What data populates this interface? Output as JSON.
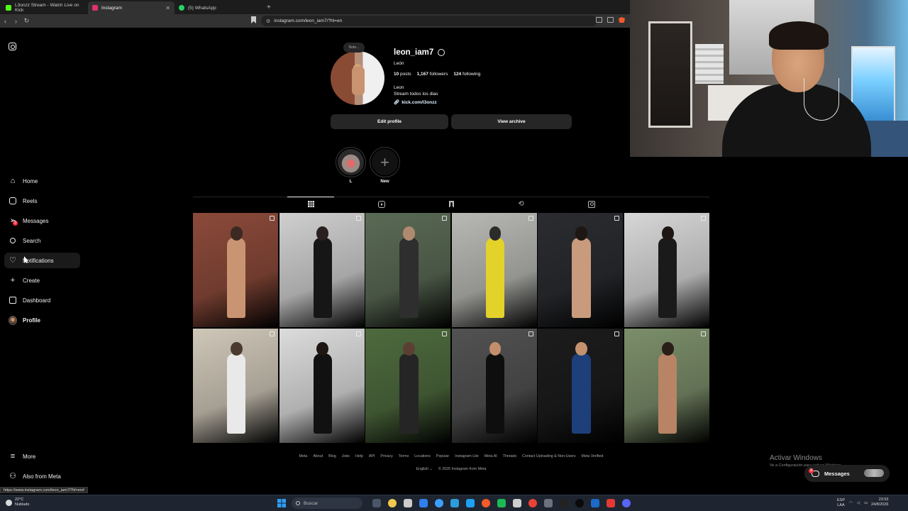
{
  "browser": {
    "tabs": [
      {
        "title": "L3onzz Stream - Watch Live on Kick",
        "color": "#53fc18"
      },
      {
        "title": "Instagram",
        "color": "#e1306c"
      },
      {
        "title": "(5) WhatsApp",
        "color": "#25d366"
      }
    ],
    "url": "instagram.com/leon_iam7/?hl=en"
  },
  "sidebar": {
    "items": [
      {
        "label": "Home",
        "icon": "home-icon"
      },
      {
        "label": "Reels",
        "icon": "reels-icon"
      },
      {
        "label": "Messages",
        "icon": "messages-icon",
        "badge": "3"
      },
      {
        "label": "Search",
        "icon": "search-icon"
      },
      {
        "label": "Notifications",
        "icon": "heart-icon"
      },
      {
        "label": "Create",
        "icon": "plus-icon"
      },
      {
        "label": "Dashboard",
        "icon": "dashboard-icon"
      },
      {
        "label": "Profile",
        "icon": "avatar"
      }
    ],
    "more": "More",
    "also_from_meta": "Also from Meta"
  },
  "profile": {
    "note": "Note...",
    "username": "leon_iam7",
    "full_name": "León",
    "posts": "10",
    "posts_label": "posts",
    "followers": "1,167",
    "followers_label": "followers",
    "following": "124",
    "following_label": "following",
    "bio_name": "Leon",
    "bio_text": "Stream todos los dias",
    "link": "kick.com/l3onzz",
    "edit_profile": "Edit profile",
    "view_archive": "View archive"
  },
  "highlights": [
    {
      "label": "L"
    },
    {
      "label": "New"
    }
  ],
  "posts": [
    {
      "bg": "#8b4a3a",
      "fig": "#c99472",
      "head": "#3b2a22"
    },
    {
      "bg": "#cfcfcf",
      "fig": "#161616",
      "head": "#2a2020"
    },
    {
      "bg": "#5a6a55",
      "fig": "#2e2e2e",
      "head": "#b08a70"
    },
    {
      "bg": "#b8b8b4",
      "fig": "#e3d22a",
      "head": "#2b2b2b"
    },
    {
      "bg": "#2a2c30",
      "fig": "#c89b7d",
      "head": "#1e1612"
    },
    {
      "bg": "#d7d7d7",
      "fig": "#1a1a1a",
      "head": "#1e1612"
    },
    {
      "bg": "#cfc7b8",
      "fig": "#e9e9e9",
      "head": "#4a3a2f"
    },
    {
      "bg": "#dcdcdc",
      "fig": "#111111",
      "head": "#1e1612"
    },
    {
      "bg": "#4e6a3e",
      "fig": "#252525",
      "head": "#5a4032"
    },
    {
      "bg": "#525252",
      "fig": "#0e0e0e",
      "head": "#c48e6c"
    },
    {
      "bg": "#1c1c1c",
      "fig": "#1d3f7a",
      "head": "#c4926f"
    },
    {
      "bg": "#7b8e6a",
      "fig": "#b88465",
      "head": "#2a1e18"
    }
  ],
  "footer": {
    "links": [
      "Meta",
      "About",
      "Blog",
      "Jobs",
      "Help",
      "API",
      "Privacy",
      "Terms",
      "Locations",
      "Popular",
      "Instagram Lite",
      "Meta AI",
      "Threads",
      "Contact Uploading & Non-Users",
      "Meta Verified"
    ],
    "language": "English",
    "copyright": "© 2026 Instagram from Meta"
  },
  "windows": {
    "activate_title": "Activar Windows",
    "activate_sub": "Ve a Configuración para activar Windows."
  },
  "messages_pill": {
    "label": "Messages",
    "badge": "3"
  },
  "status_url": "https://www.instagram.com/leon_iam7/?hl=en#",
  "taskbar": {
    "temp": "22°C",
    "weather": "Nublado",
    "search_placeholder": "Buscar",
    "lang1": "ESP",
    "lang2": "LAA",
    "time": "23:53",
    "date": "24/8/2026",
    "apps": [
      "#4a5568",
      "#f2c94c",
      "#cccccc",
      "#2f80ed",
      "#3aa0ff",
      "#2d9cdb",
      "#1da1f2",
      "#f35b2a",
      "#1db954",
      "#cfcfcf",
      "#ea4335",
      "#6b7280",
      "#222222",
      "#0a0a0a",
      "#1b6ac9",
      "#e53935",
      "#5865f2"
    ]
  }
}
